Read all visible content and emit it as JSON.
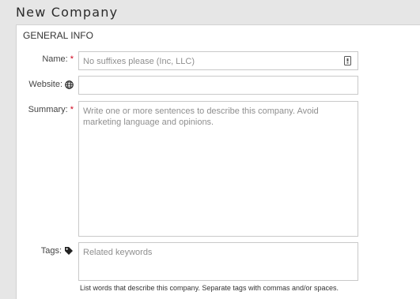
{
  "page": {
    "title": "New Company"
  },
  "section": {
    "title": "GENERAL INFO"
  },
  "fields": {
    "name": {
      "label": "Name:",
      "required_mark": "*",
      "placeholder": "No suffixes please (Inc, LLC)",
      "icon": "keyboard-icon"
    },
    "website": {
      "label": "Website:",
      "icon": "globe-icon",
      "placeholder": ""
    },
    "summary": {
      "label": "Summary:",
      "required_mark": "*",
      "placeholder": "Write one or more sentences to describe this company. Avoid marketing language and opinions."
    },
    "tags": {
      "label": "Tags:",
      "icon": "tag-icon",
      "placeholder": "Related keywords",
      "hint": "List words that describe this company. Separate tags with commas and/or spaces."
    }
  },
  "colors": {
    "required": "#d0021b",
    "border": "#c9c9c9",
    "background": "#e6e6e6"
  }
}
